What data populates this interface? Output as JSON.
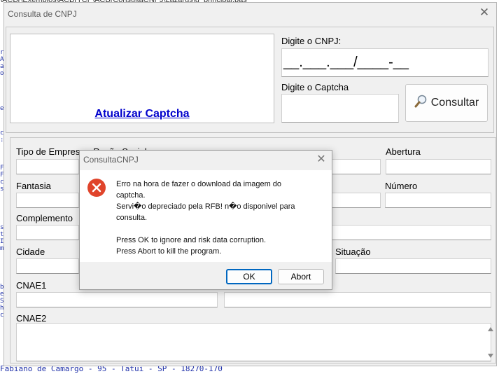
{
  "background": {
    "path_text": "\\ACBr\\Exemplos\\ACBrTCP\\ACBrConsultaCNPJ\\Lazarus\\u_principal.pas",
    "bottom_text": "Fabiano de Camargo - 95 - Tatui - SP - 18270-170"
  },
  "window": {
    "title": "Consulta de CNPJ",
    "close_glyph": "✕"
  },
  "top_form": {
    "captcha_link": "Atualizar Captcha",
    "cnpj_label": "Digite o CNPJ:",
    "cnpj_value": "__.___.___/____-__",
    "captcha_label": "Digite o Captcha",
    "captcha_value": "",
    "consult_button": "Consultar",
    "consult_icon": "magnifier-icon"
  },
  "fields": {
    "tipo_empresa_label": "Tipo de Empresa",
    "razao_social_label": "Razão Social",
    "abertura_label": "Abertura",
    "fantasia_label": "Fantasia",
    "numero_label": "Número",
    "complemento_label": "Complemento",
    "cidade_label": "Cidade",
    "situacao_label": "Situação",
    "cnae1_label": "CNAE1",
    "cnae2_label": "CNAE2"
  },
  "dialog": {
    "title": "ConsultaCNPJ",
    "close_glyph": "✕",
    "icon": "error-icon",
    "message": "Erro na hora de fazer o download da imagem do\ncaptcha.\nServi�o depreciado pela RFB! n�o disponivel para\nconsulta.\n\nPress OK to ignore and risk data corruption.\nPress Abort to kill the program.",
    "ok_button": "OK",
    "abort_button": "Abort"
  }
}
